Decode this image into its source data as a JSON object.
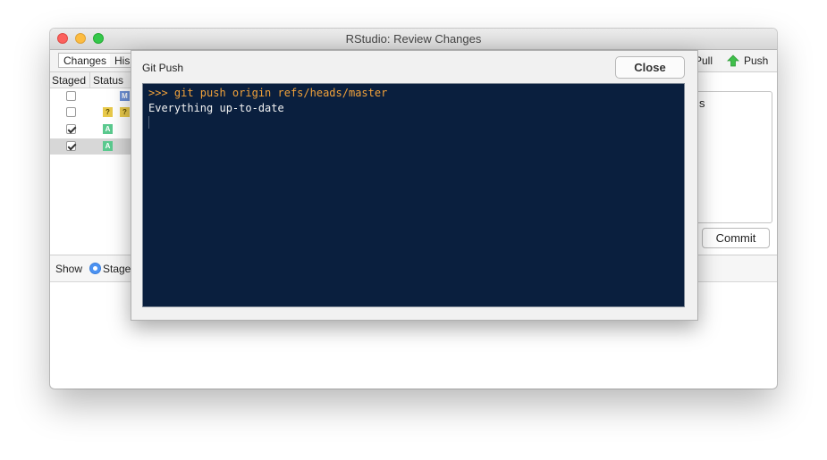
{
  "window": {
    "title": "RStudio: Review Changes"
  },
  "toolbar": {
    "tabs": [
      {
        "label": "Changes"
      },
      {
        "label": "His"
      }
    ],
    "pull_label": "Pull",
    "push_label": "Push"
  },
  "file_list": {
    "columns": {
      "staged": "Staged",
      "status": "Status"
    },
    "rows": [
      {
        "staged": false,
        "status": [
          "M"
        ]
      },
      {
        "staged": false,
        "status": [
          "?",
          "?"
        ]
      },
      {
        "staged": true,
        "status": [
          "A"
        ]
      },
      {
        "staged": true,
        "status": [
          "A"
        ],
        "selected": true
      }
    ]
  },
  "commit": {
    "message_fragment": "s",
    "button_label": "Commit"
  },
  "show_bar": {
    "label": "Show",
    "option": "Staged"
  },
  "dialog": {
    "title": "Git Push",
    "close_label": "Close",
    "console": {
      "command": ">>> git push origin refs/heads/master",
      "output": "Everything up-to-date"
    }
  },
  "colors": {
    "console_bg": "#0a1f3e",
    "command_text": "#f2a23a",
    "output_text": "#f2f2f2",
    "push_arrow": "#3fbf4a",
    "radio_accent": "#4b92f2"
  }
}
